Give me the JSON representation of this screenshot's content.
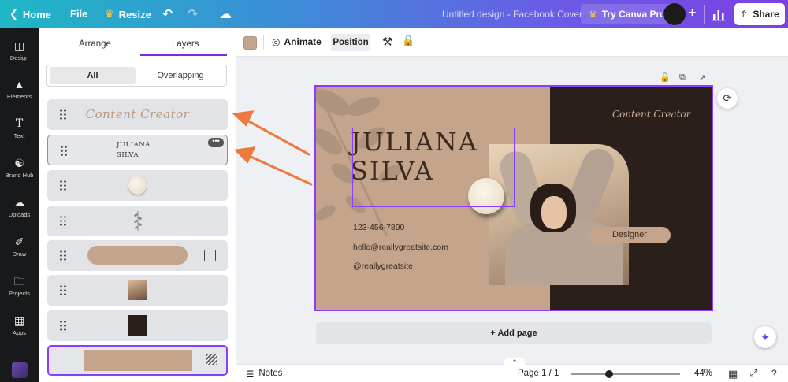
{
  "topbar": {
    "home": "Home",
    "file": "File",
    "resize": "Resize",
    "title": "Untitled design - Facebook Cover",
    "try_pro": "Try Canva Pro",
    "share": "Share"
  },
  "rail": {
    "items": [
      "Design",
      "Elements",
      "Text",
      "Brand Hub",
      "Uploads",
      "Draw",
      "Projects",
      "Apps"
    ]
  },
  "panel": {
    "tabs": [
      "Arrange",
      "Layers"
    ],
    "active_tab": "Layers",
    "filters": [
      "All",
      "Overlapping"
    ],
    "active_filter": "All",
    "layers": {
      "content_creator": "Content Creator",
      "name_line1": "JULIANA",
      "name_line2": "SILVA"
    }
  },
  "canvas_toolbar": {
    "swatch_color": "#c4a58c",
    "animate": "Animate",
    "position": "Position"
  },
  "design": {
    "name_line1": "JULIANA",
    "name_line2": "SILVA",
    "role_text": "Content Creator",
    "phone": "123-456-7890",
    "email": "hello@reallygreatsite.com",
    "handle": "@reallygreatsite",
    "tag": "Designer",
    "bg_color": "#c4a58c",
    "dark_color": "#2b1f1b"
  },
  "add_page": "+ Add page",
  "bottombar": {
    "notes": "Notes",
    "page": "Page 1 / 1",
    "zoom": "44%",
    "zoom_fraction": 0.35
  }
}
